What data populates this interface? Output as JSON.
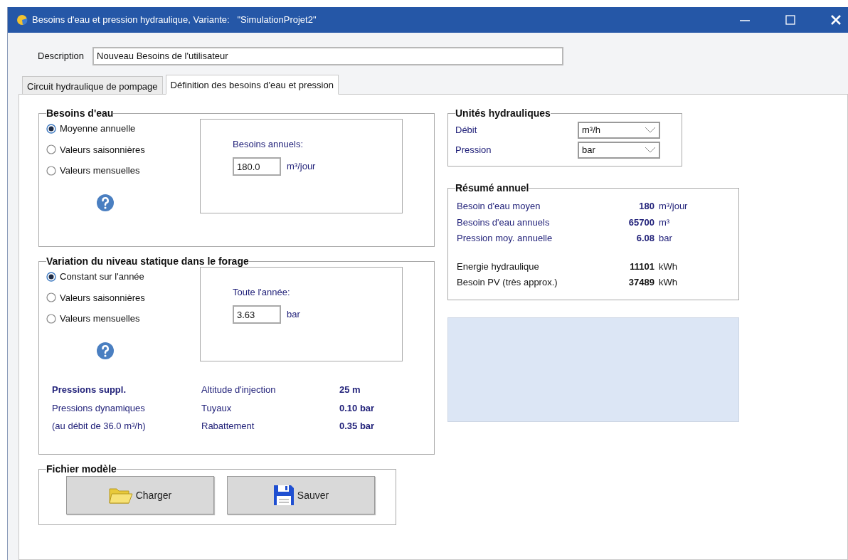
{
  "window": {
    "title": "Besoins d'eau et pression hydraulique, Variante:   \"SimulationProjet2\""
  },
  "description": {
    "label": "Description",
    "value": "Nouveau Besoins de l'utilisateur"
  },
  "tabs": [
    {
      "label": "Circuit hydraulique de pompage",
      "selected": false
    },
    {
      "label": "Définition des besoins d'eau et pression",
      "selected": true
    }
  ],
  "water_needs": {
    "title": "Besoins d'eau",
    "options": [
      {
        "label": "Moyenne annuelle",
        "selected": true
      },
      {
        "label": "Valeurs saisonnières",
        "selected": false
      },
      {
        "label": "Valeurs mensuelles",
        "selected": false
      }
    ],
    "input": {
      "label": "Besoins annuels:",
      "value": "180.0",
      "unit": "m³/jour"
    }
  },
  "static_level": {
    "title": "Variation du niveau statique dans le forage",
    "options": [
      {
        "label": "Constant sur l'année",
        "selected": true
      },
      {
        "label": "Valeurs saisonnières",
        "selected": false
      },
      {
        "label": "Valeurs mensuelles",
        "selected": false
      }
    ],
    "input": {
      "label": "Toute l'année:",
      "value": "3.63",
      "unit": "bar"
    },
    "extra": {
      "title": "Pressions suppl.",
      "notes": [
        "Pressions dynamiques",
        "(au débit de 36.0 m³/h)"
      ],
      "rows": [
        {
          "label": "Altitude d'injection",
          "value": "25 m"
        },
        {
          "label": "Tuyaux",
          "value": "0.10 bar"
        },
        {
          "label": "Rabattement",
          "value": "0.35 bar"
        }
      ]
    }
  },
  "template_file": {
    "title": "Fichier modèle",
    "buttons": [
      {
        "label": "Charger",
        "kind": "load"
      },
      {
        "label": "Sauver",
        "kind": "save"
      }
    ]
  },
  "units": {
    "title": "Unités hydrauliques",
    "rows": [
      {
        "label": "Débit",
        "value": "m³/h"
      },
      {
        "label": "Pression",
        "value": "bar"
      }
    ]
  },
  "summary": {
    "title": "Résumé annuel",
    "water_rows": [
      {
        "label": "Besoin d'eau moyen",
        "value": "180",
        "unit": "m³/jour"
      },
      {
        "label": "Besoins d'eau annuels",
        "value": "65700",
        "unit": "m³"
      },
      {
        "label": "Pression moy. annuelle",
        "value": "6.08",
        "unit": "bar"
      }
    ],
    "energy_rows": [
      {
        "label": "Energie hydraulique",
        "value": "11101",
        "unit": "kWh"
      },
      {
        "label": "Besoin PV (très approx.)",
        "value": "37489",
        "unit": "kWh"
      }
    ]
  }
}
